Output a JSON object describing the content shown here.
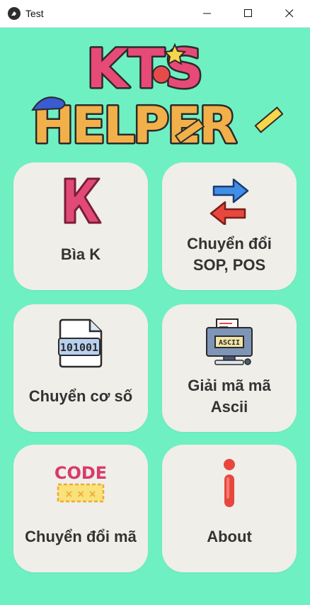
{
  "window": {
    "title": "Test"
  },
  "logo": {
    "line1": "KTS",
    "line2": "HELPER"
  },
  "cards": [
    {
      "label": "Bìa K",
      "icon": "letter-k-icon"
    },
    {
      "label": "Chuyển đổi SOP, POS",
      "icon": "swap-arrows-icon"
    },
    {
      "label": "Chuyển cơ số",
      "icon": "binary-file-icon"
    },
    {
      "label": "Giải mã mã Ascii",
      "icon": "ascii-computer-icon"
    },
    {
      "label": "Chuyển đổi mã",
      "icon": "code-icon"
    },
    {
      "label": "About",
      "icon": "info-icon"
    }
  ],
  "icon_text": {
    "binary": "101001",
    "ascii": "ASCII",
    "code": "CODE"
  },
  "colors": {
    "background": "#6ff0c2",
    "card": "#efeee8",
    "text": "#333333"
  }
}
